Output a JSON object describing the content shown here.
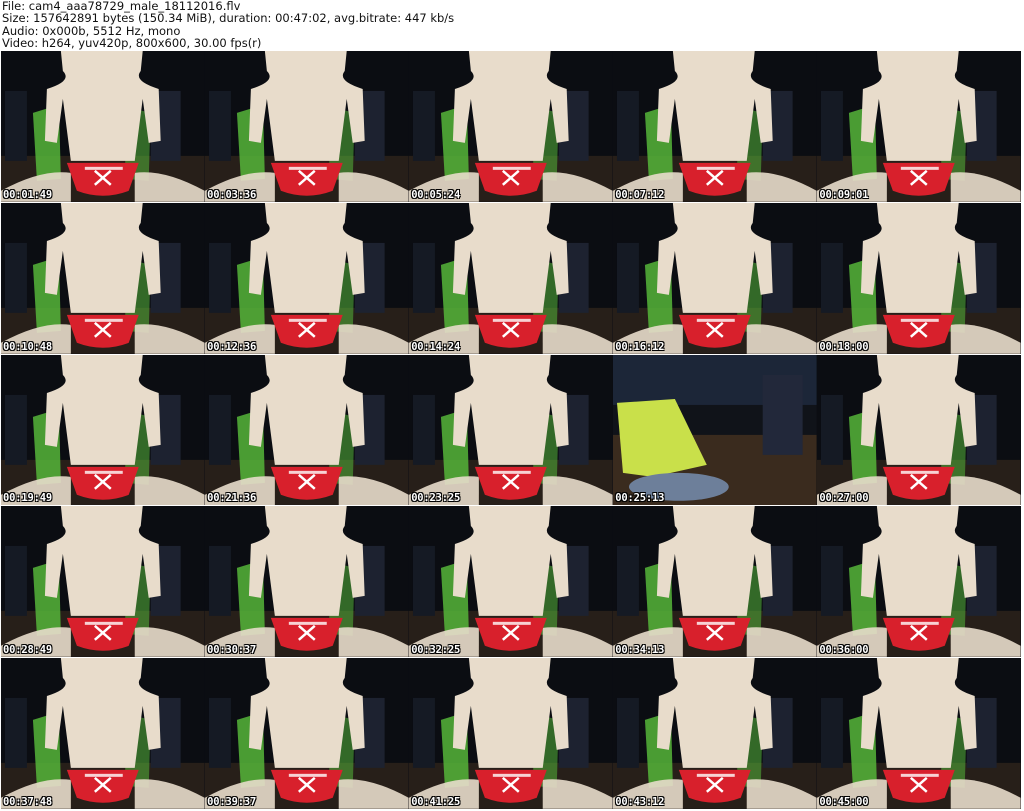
{
  "header": {
    "file_line": "File: cam4_aaa78729_male_18112016.flv",
    "size_line": "Size: 157642891 bytes (150.34 MiB), duration: 00:47:02, avg.bitrate: 447 kb/s",
    "audio_line": "Audio: 0x000b, 5512 Hz, mono",
    "video_line": "Video: h264, yuv420p, 800x600, 30.00 fps(r)"
  },
  "thumbnails": [
    {
      "timestamp": "00:01:49",
      "scene": "person-red-briefs"
    },
    {
      "timestamp": "00:03:36",
      "scene": "person-red-briefs"
    },
    {
      "timestamp": "00:05:24",
      "scene": "person-red-briefs"
    },
    {
      "timestamp": "00:07:12",
      "scene": "person-red-briefs"
    },
    {
      "timestamp": "00:09:01",
      "scene": "person-red-briefs"
    },
    {
      "timestamp": "00:10:48",
      "scene": "person-red-briefs"
    },
    {
      "timestamp": "00:12:36",
      "scene": "person-red-briefs"
    },
    {
      "timestamp": "00:14:24",
      "scene": "person-red-briefs"
    },
    {
      "timestamp": "00:16:12",
      "scene": "person-red-briefs"
    },
    {
      "timestamp": "00:18:00",
      "scene": "person-red-briefs"
    },
    {
      "timestamp": "00:19:49",
      "scene": "person-red-briefs"
    },
    {
      "timestamp": "00:21:36",
      "scene": "person-red-briefs"
    },
    {
      "timestamp": "00:23:25",
      "scene": "person-red-briefs"
    },
    {
      "timestamp": "00:25:13",
      "scene": "empty-chair"
    },
    {
      "timestamp": "00:27:00",
      "scene": "person-red-briefs"
    },
    {
      "timestamp": "00:28:49",
      "scene": "person-red-briefs"
    },
    {
      "timestamp": "00:30:37",
      "scene": "person-red-briefs"
    },
    {
      "timestamp": "00:32:25",
      "scene": "person-red-briefs"
    },
    {
      "timestamp": "00:34:13",
      "scene": "person-red-briefs"
    },
    {
      "timestamp": "00:36:00",
      "scene": "person-red-briefs"
    },
    {
      "timestamp": "00:37:48",
      "scene": "person-red-briefs"
    },
    {
      "timestamp": "00:39:37",
      "scene": "person-red-briefs"
    },
    {
      "timestamp": "00:41:25",
      "scene": "person-red-briefs"
    },
    {
      "timestamp": "00:43:12",
      "scene": "person-red-briefs"
    },
    {
      "timestamp": "00:45:00",
      "scene": "person-red-briefs"
    }
  ],
  "colors": {
    "background": "#0b0d12",
    "skin": "#e8dccb",
    "briefs": "#d8202c",
    "chair": "#56b63a",
    "floor": "#3a2b1e",
    "towel": "#c9e04a"
  }
}
